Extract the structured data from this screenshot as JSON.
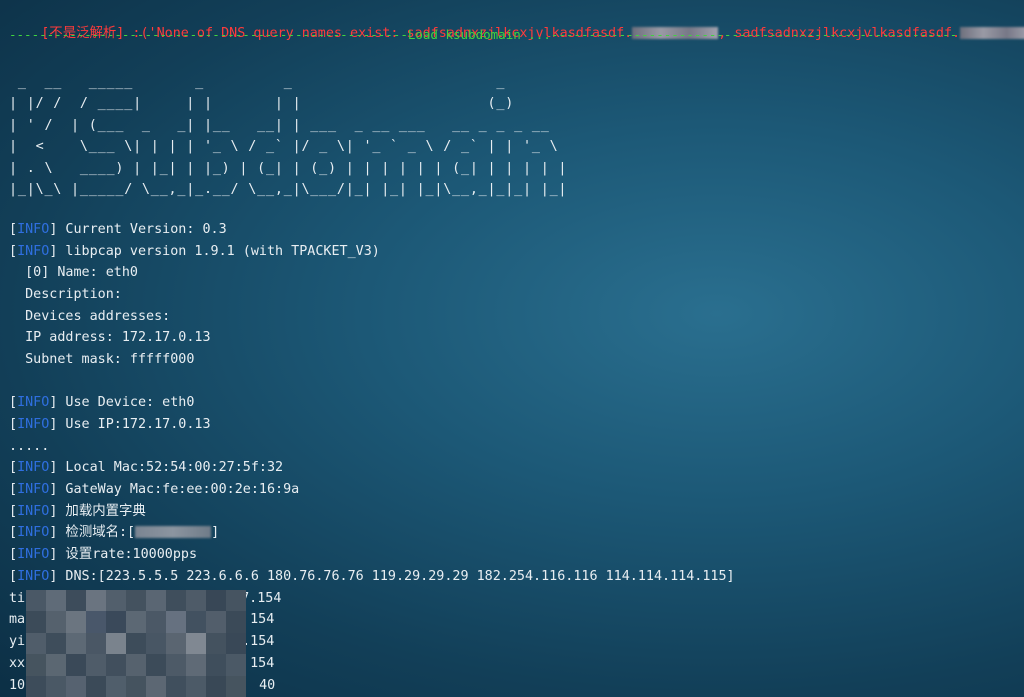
{
  "error_line": {
    "prefix": "[不是泛解析]",
    "text": " :('None of DNS query names exist: sadfsadnxzjlkcxjvlkasdfasdf.",
    "mid": ", sadfsadnxzjlkcxjvlkasdfasdf.",
    "suffix": "'.)"
  },
  "load_banner": "-----------------------------------------------------Load ksubdomain ...------------------------------------------------------",
  "ascii_art": [
    " _  __   _____       _         _                       _",
    "| |/ /  / ____|     | |       | |                     (_)",
    "| ' /  | (___  _   _| |__   __| | ___  _ __ ___   __ _ _ _ __",
    "|  <    \\___ \\| | | | '_ \\ / _` |/ _ \\| '_ ` _ \\ / _` | | '_ \\",
    "| . \\   ____) | |_| | |_) | (_| | (_) | | | | | | (_| | | | | |",
    "|_|\\_\\ |_____/ \\__,_|_.__/ \\__,_|\\___/|_| |_| |_|\\__,_|_|_| |_|"
  ],
  "info_tag": "INFO",
  "logs": {
    "version": " Current Version: 0.3",
    "libpcap": " libpcap version 1.9.1 (with TPACKET_V3)",
    "dev_name": "  [0] Name: eth0",
    "dev_desc": "  Description:",
    "dev_addrs": "  Devices addresses:",
    "dev_ip": "  IP address: 172.17.0.13",
    "dev_mask": "  Subnet mask: fffff000",
    "use_device": " Use Device: eth0",
    "use_ip": " Use IP:172.17.0.13",
    "dots": ".....",
    "local_mac": " Local Mac:52:54:00:27:5f:32",
    "gateway_mac": " GateWay Mac:fe:ee:00:2e:16:9a",
    "load_dict": " 加载内置字典",
    "detect_domain_prefix": " 检测域名:[",
    "detect_domain_suffix": "]",
    "rate": " 设置rate:10000pps",
    "dns": " DNS:[223.5.5.5 223.6.6.6 180.76.76.76 119.29.29.29 182.254.116.116 114.114.114.115]"
  },
  "results": [
    {
      "left": "ti",
      "right": "7.154"
    },
    {
      "left": "ma",
      "right": "154"
    },
    {
      "left": "yi",
      "right": ".154"
    },
    {
      "left": "xx",
      "right": "154"
    },
    {
      "left": "10",
      "right": "40"
    }
  ]
}
